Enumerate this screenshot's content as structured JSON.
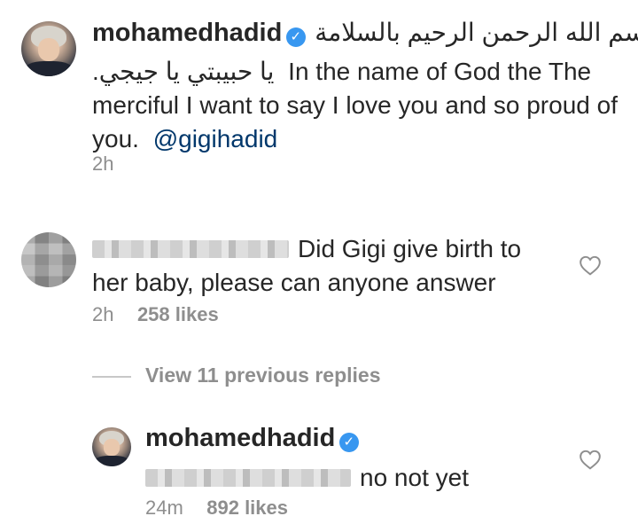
{
  "post": {
    "username": "mohamedhadid",
    "verified_icon": "verified-badge-icon",
    "arabic_line1": "بسم الله الرحمن الرحيم بالسلامة",
    "arabic_line2": "يا حبيبتي يا جيجي.",
    "text_line2_en": "In the name of God the The",
    "text_line3": "merciful I want to say I love you and so proud of",
    "text_line4": "you.",
    "mention": "@gigihadid",
    "time": "2h"
  },
  "reply": {
    "username_redacted": true,
    "text_line1": "Did Gigi give birth to",
    "text_line2": "her baby, please can anyone answer",
    "time": "2h",
    "likes": "258 likes"
  },
  "thread": {
    "view_replies": "View 11 previous replies"
  },
  "nested_reply": {
    "username": "mohamedhadid",
    "verified_icon": "verified-badge-icon",
    "text": "no not yet",
    "time": "24m",
    "likes": "892 likes"
  },
  "colors": {
    "text": "#262626",
    "meta": "#8e8e8e",
    "mention": "#00376b",
    "verified": "#3897f0"
  }
}
